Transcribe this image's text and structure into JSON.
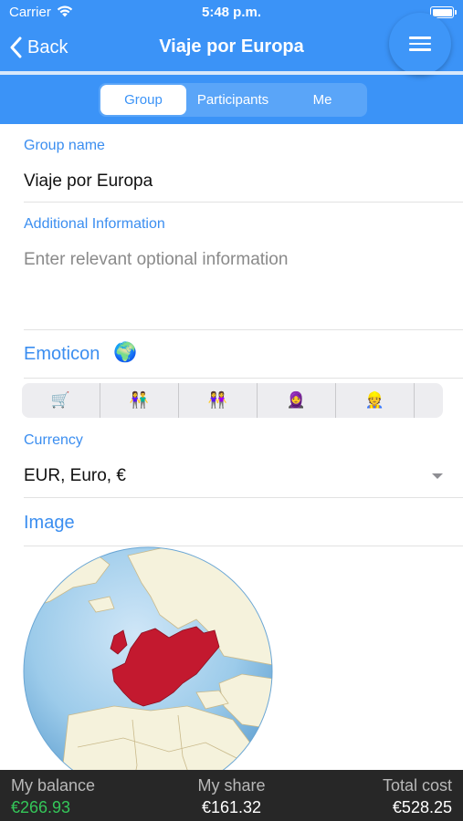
{
  "status": {
    "carrier": "Carrier",
    "time": "5:48 p.m."
  },
  "nav": {
    "back_label": "Back",
    "title": "Viaje por Europa"
  },
  "tabs": [
    {
      "label": "Group",
      "active": true
    },
    {
      "label": "Participants",
      "active": false
    },
    {
      "label": "Me",
      "active": false
    }
  ],
  "form": {
    "group_name_label": "Group name",
    "group_name_value": "Viaje por Europa",
    "additional_info_label": "Additional Information",
    "additional_info_placeholder": "Enter relevant optional information",
    "emoticon_label": "Emoticon",
    "emoticon_selected": "🌍",
    "emoticon_options": [
      "🛒",
      "👫",
      "👭",
      "🧕",
      "👷"
    ],
    "currency_label": "Currency",
    "currency_value": "EUR, Euro, €",
    "image_label": "Image"
  },
  "footer": {
    "balance_label": "My balance",
    "balance_value": "€266.93",
    "share_label": "My share",
    "share_value": "€161.32",
    "total_label": "Total cost",
    "total_value": "€528.25"
  },
  "colors": {
    "accent": "#3b93f7",
    "label_blue": "#3b8ef0",
    "balance_green": "#34c759",
    "footer_bg": "#272727"
  }
}
